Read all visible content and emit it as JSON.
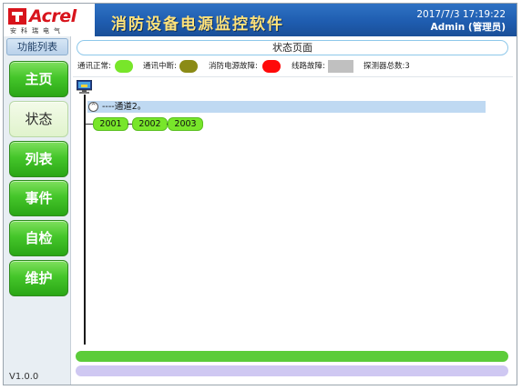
{
  "header": {
    "logo_text": "Acrel",
    "logo_sub": "安科瑞电气",
    "app_title": "消防设备电源监控软件",
    "datetime": "2017/7/3 17:19:22",
    "user": "Admin (管理员)"
  },
  "sidebar": {
    "title": "功能列表",
    "items": [
      {
        "label": "主页"
      },
      {
        "label": "状态"
      },
      {
        "label": "列表"
      },
      {
        "label": "事件"
      },
      {
        "label": "自检"
      },
      {
        "label": "维护"
      }
    ],
    "active": "状态",
    "version": "V1.0.0"
  },
  "main": {
    "page_title": "状态页面",
    "legend": {
      "normal_label": "通讯正常:",
      "normal_color": "#78e62a",
      "comm_break_label": "通讯中断:",
      "comm_break_color": "#8b8b16",
      "power_fault_label": "消防电源故障:",
      "power_fault_color": "#ff0a0a",
      "line_fault_label": "线路故障:",
      "line_fault_color": "#c0c0c0",
      "total_label": "探测器总数:3"
    },
    "tree": {
      "channel_label": "----通道2。",
      "expander": "^",
      "devices": [
        "2001",
        "2002",
        "2003"
      ]
    }
  }
}
